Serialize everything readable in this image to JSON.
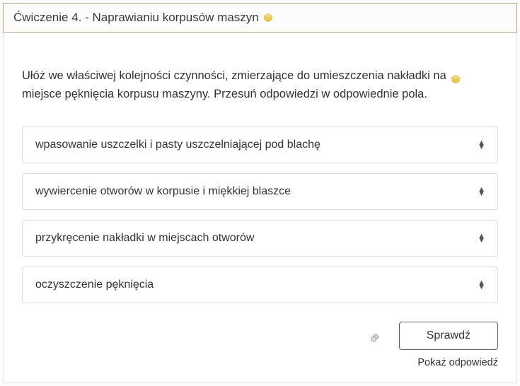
{
  "header": {
    "title": "Ćwiczenie 4. - Naprawianiu korpusów maszyn"
  },
  "instruction_part1": "Ułóż we właściwej kolejności czynności, zmierzające do umieszczenia nakładki na",
  "instruction_part2": "miejsce pęknięcia korpusu maszyny. Przesuń odpowiedzi w odpowiednie pola.",
  "options": [
    {
      "text": "wpasowanie uszczelki i pasty uszczelniającej pod blachę"
    },
    {
      "text": "wywiercenie otworów w korpusie i miękkiej blaszce"
    },
    {
      "text": "przykręcenie nakładki w miejscach otworów"
    },
    {
      "text": "oczyszczenie pęknięcia"
    }
  ],
  "footer": {
    "check_label": "Sprawdź",
    "show_answer_label": "Pokaż odpowiedź"
  }
}
